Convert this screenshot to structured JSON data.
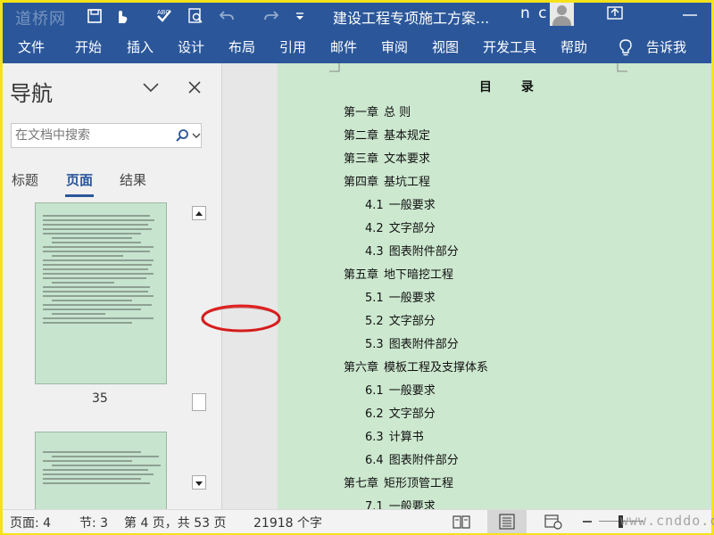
{
  "titlebar": {
    "logo_text": "道桥网",
    "doc_title": "建设工程专项施工方案...",
    "user": "n c"
  },
  "menu": {
    "tabs": [
      "文件",
      "开始",
      "插入",
      "设计",
      "布局",
      "引用",
      "邮件",
      "审阅",
      "视图",
      "开发工具",
      "帮助"
    ],
    "tell_me": "告诉我"
  },
  "nav": {
    "title": "导航",
    "search_placeholder": "在文档中搜索",
    "tabs": [
      "标题",
      "页面",
      "结果"
    ],
    "active_tab": "页面",
    "thumbnail_page_number": "35"
  },
  "document": {
    "toc_title": "目 录",
    "toc": [
      {
        "num": "第一章",
        "text": "总 则"
      },
      {
        "num": "第二章",
        "text": "基本规定"
      },
      {
        "num": "第三章",
        "text": "文本要求"
      },
      {
        "num": "第四章",
        "text": "基坑工程"
      },
      {
        "num": "4.1",
        "text": "一般要求"
      },
      {
        "num": "4.2",
        "text": "文字部分"
      },
      {
        "num": "4.3",
        "text": "图表附件部分"
      },
      {
        "num": "第五章",
        "text": "地下暗挖工程"
      },
      {
        "num": "5.1",
        "text": "一般要求"
      },
      {
        "num": "5.2",
        "text": "文字部分"
      },
      {
        "num": "5.3",
        "text": "图表附件部分"
      },
      {
        "num": "第六章",
        "text": "模板工程及支撑体系"
      },
      {
        "num": "6.1",
        "text": "一般要求"
      },
      {
        "num": "6.2",
        "text": "文字部分"
      },
      {
        "num": "6.3",
        "text": "计算书"
      },
      {
        "num": "6.4",
        "text": "图表附件部分"
      },
      {
        "num": "第七章",
        "text": "矩形顶管工程"
      },
      {
        "num": "7.1",
        "text": "一般要求"
      }
    ]
  },
  "status": {
    "page": "页面: 4",
    "section": "节: 3",
    "page_of": "第 4 页，共 53 页",
    "words": "21918 个字",
    "watermark": "www.cnddo.com"
  },
  "colors": {
    "brand": "#2b579a",
    "page_green": "#cce8cf",
    "annotation_red": "#e02020"
  }
}
